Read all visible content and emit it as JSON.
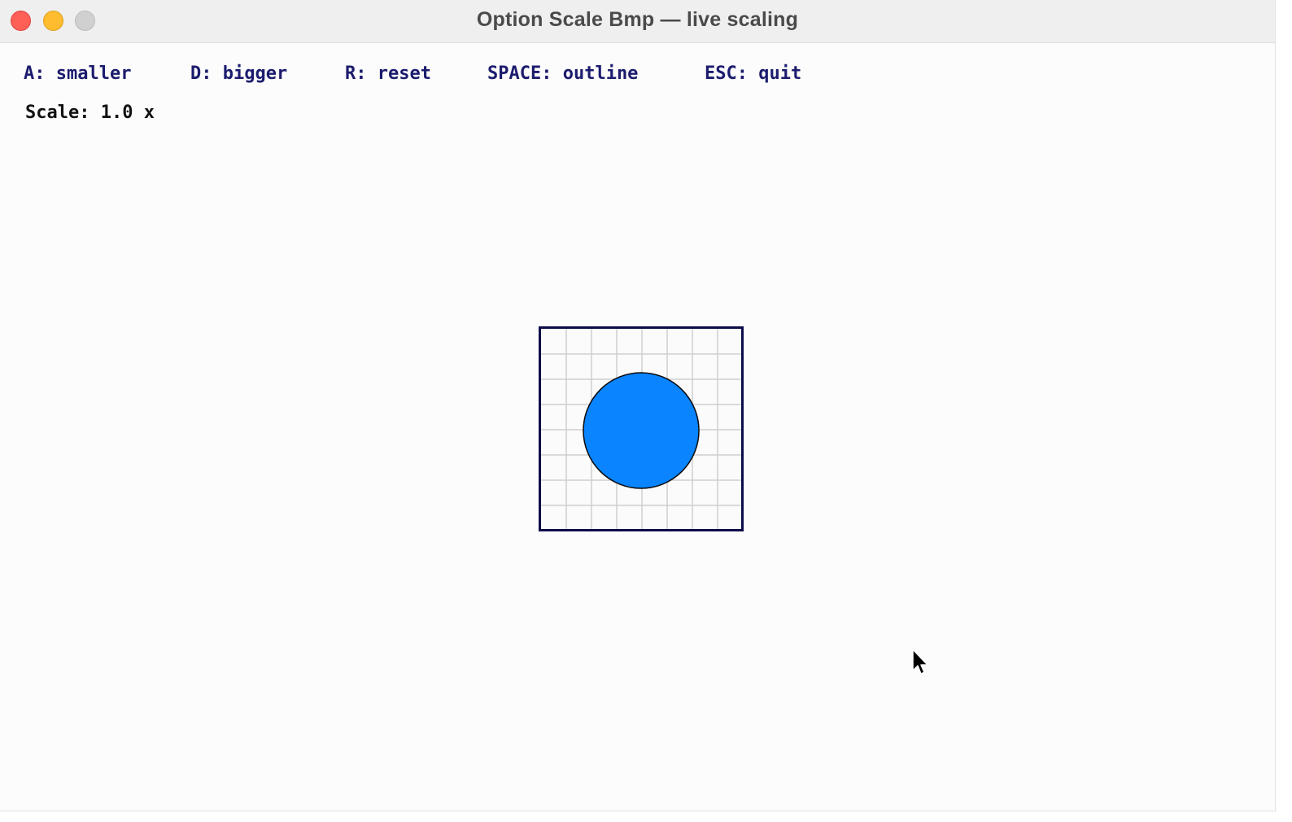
{
  "window": {
    "title": "Option Scale Bmp — live scaling"
  },
  "controls": {
    "items": [
      {
        "key": "A",
        "label": "A: smaller"
      },
      {
        "key": "D",
        "label": "D: bigger"
      },
      {
        "key": "R",
        "label": "R: reset"
      },
      {
        "key": "SPACE",
        "label": "SPACE: outline"
      },
      {
        "key": "ESC",
        "label": "ESC: quit"
      }
    ]
  },
  "status": {
    "scale_label": "Scale:",
    "scale_value": "1.0 x"
  },
  "sprite": {
    "shape": "circle",
    "fill_color": "#0a84ff",
    "outline_color": "#0a0a0a",
    "frame_color": "#0c0c4a",
    "grid_color": "#cfcfcf",
    "background_color": "#fbfbfb"
  },
  "icons": {
    "cursor": "arrow-cursor-icon",
    "close": "close-dot-icon",
    "minimize": "minimize-dot-icon",
    "zoom": "zoom-dot-icon"
  }
}
